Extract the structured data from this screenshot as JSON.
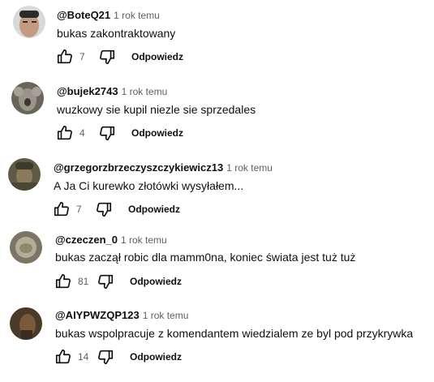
{
  "comments": [
    {
      "author": "@BoteQ21",
      "time": "1 rok temu",
      "text": "bukas zakontraktowany",
      "likes": "7",
      "reply_label": "Odpowiedz",
      "avatar_colors": [
        "#d9d9d9",
        "#c49a83"
      ]
    },
    {
      "author": "@bujek2743",
      "time": "1 rok temu",
      "text": "wuzkowy sie kupil niezle sie sprzedales",
      "likes": "4",
      "reply_label": "Odpowiedz",
      "avatar_colors": [
        "#6b6458",
        "#9a958a"
      ]
    },
    {
      "author": "@grzegorzbrzeczyszczykiewicz13",
      "time": "1 rok temu",
      "text": "A Ja Ci kurewko złotówki wysyłałem...",
      "likes": "7",
      "reply_label": "Odpowiedz",
      "avatar_colors": [
        "#5e5a45",
        "#8a7a5c"
      ]
    },
    {
      "author": "@czeczen_0",
      "time": "1 rok temu",
      "text": "bukas zaczął robic dla mamm0na, koniec świata jest tuż tuż",
      "likes": "81",
      "reply_label": "Odpowiedz",
      "avatar_colors": [
        "#7d7466",
        "#b6ad97"
      ]
    },
    {
      "author": "@AIYPWZQP123",
      "time": "1 rok temu",
      "text": "bukas wspolpracuje z komendantem wiedzialem ze byl pod przykrywka",
      "likes": "14",
      "reply_label": "Odpowiedz",
      "avatar_colors": [
        "#4a3a2a",
        "#7a5a3a"
      ]
    }
  ]
}
